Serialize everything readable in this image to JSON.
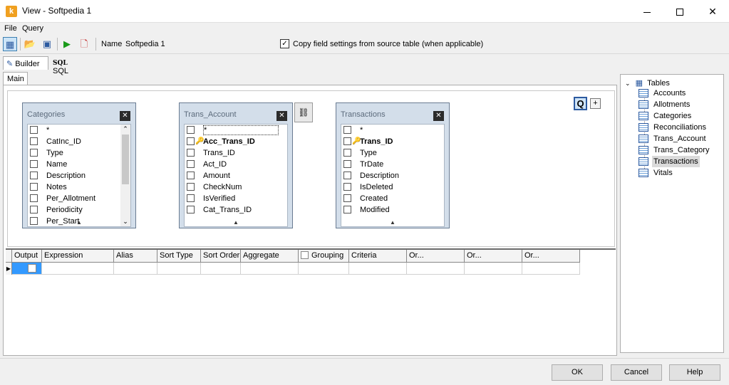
{
  "window": {
    "title": "View - Softpedia 1"
  },
  "menu": [
    "File",
    "Query"
  ],
  "toolbar": {
    "name_label": "Name",
    "name_value": "Softpedia 1",
    "copy_checked": true,
    "copy_label": "Copy field settings from source table (when applicable)"
  },
  "tabs": {
    "builder": "Builder",
    "sql_icon": "SQL",
    "sql": "SQL",
    "main": "Main"
  },
  "tables": [
    {
      "name": "Categories",
      "fields": [
        "*",
        "CatInc_ID",
        "Type",
        "Name",
        "Description",
        "Notes",
        "Per_Allotment",
        "Periodicity",
        "Per_Start"
      ]
    },
    {
      "name": "Trans_Account",
      "fields": [
        "*",
        "Acc_Trans_ID",
        "Trans_ID",
        "Act_ID",
        "Amount",
        "CheckNum",
        "IsVerified",
        "Cat_Trans_ID"
      ]
    },
    {
      "name": "Transactions",
      "fields": [
        "*",
        "Trans_ID",
        "Type",
        "TrDate",
        "Description",
        "IsDeleted",
        "Created",
        "Modified"
      ]
    }
  ],
  "diagram": {
    "q_label": "Q",
    "plus_label": "+"
  },
  "grid": {
    "columns": [
      "Output",
      "Expression",
      "Alias",
      "Sort Type",
      "Sort Order",
      "Aggregate",
      "Grouping",
      "Criteria",
      "Or...",
      "Or...",
      "Or..."
    ]
  },
  "tree": {
    "root": "Tables",
    "items": [
      "Accounts",
      "Allotments",
      "Categories",
      "Reconciliations",
      "Trans_Account",
      "Trans_Category",
      "Transactions",
      "Vitals"
    ],
    "selected": "Transactions"
  },
  "buttons": {
    "ok": "OK",
    "cancel": "Cancel",
    "help": "Help"
  },
  "colors": {
    "accent": "#3399ff",
    "table_frame": "#d3deea",
    "selection": "#cce4f7"
  }
}
